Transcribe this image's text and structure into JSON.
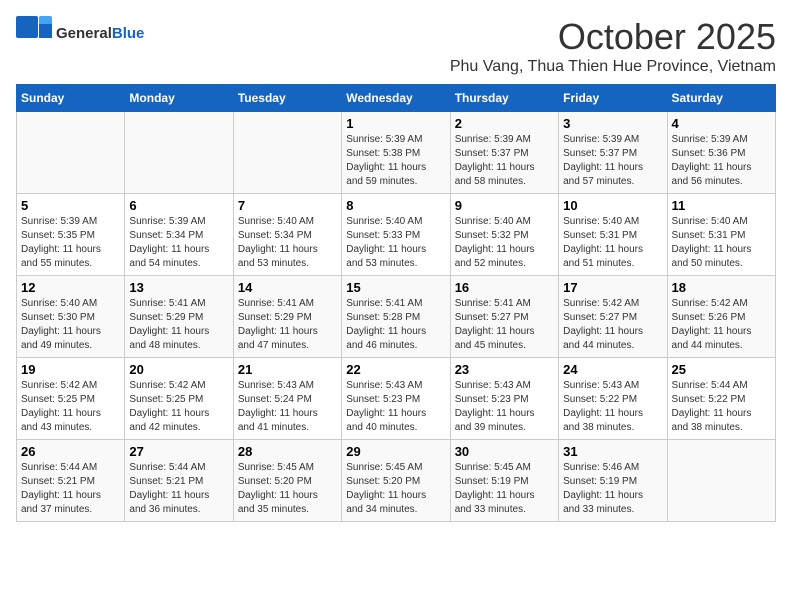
{
  "header": {
    "logo_general": "General",
    "logo_blue": "Blue",
    "month": "October 2025",
    "location": "Phu Vang, Thua Thien Hue Province, Vietnam"
  },
  "weekdays": [
    "Sunday",
    "Monday",
    "Tuesday",
    "Wednesday",
    "Thursday",
    "Friday",
    "Saturday"
  ],
  "weeks": [
    [
      {
        "day": "",
        "info": ""
      },
      {
        "day": "",
        "info": ""
      },
      {
        "day": "",
        "info": ""
      },
      {
        "day": "1",
        "info": "Sunrise: 5:39 AM\nSunset: 5:38 PM\nDaylight: 11 hours\nand 59 minutes."
      },
      {
        "day": "2",
        "info": "Sunrise: 5:39 AM\nSunset: 5:37 PM\nDaylight: 11 hours\nand 58 minutes."
      },
      {
        "day": "3",
        "info": "Sunrise: 5:39 AM\nSunset: 5:37 PM\nDaylight: 11 hours\nand 57 minutes."
      },
      {
        "day": "4",
        "info": "Sunrise: 5:39 AM\nSunset: 5:36 PM\nDaylight: 11 hours\nand 56 minutes."
      }
    ],
    [
      {
        "day": "5",
        "info": "Sunrise: 5:39 AM\nSunset: 5:35 PM\nDaylight: 11 hours\nand 55 minutes."
      },
      {
        "day": "6",
        "info": "Sunrise: 5:39 AM\nSunset: 5:34 PM\nDaylight: 11 hours\nand 54 minutes."
      },
      {
        "day": "7",
        "info": "Sunrise: 5:40 AM\nSunset: 5:34 PM\nDaylight: 11 hours\nand 53 minutes."
      },
      {
        "day": "8",
        "info": "Sunrise: 5:40 AM\nSunset: 5:33 PM\nDaylight: 11 hours\nand 53 minutes."
      },
      {
        "day": "9",
        "info": "Sunrise: 5:40 AM\nSunset: 5:32 PM\nDaylight: 11 hours\nand 52 minutes."
      },
      {
        "day": "10",
        "info": "Sunrise: 5:40 AM\nSunset: 5:31 PM\nDaylight: 11 hours\nand 51 minutes."
      },
      {
        "day": "11",
        "info": "Sunrise: 5:40 AM\nSunset: 5:31 PM\nDaylight: 11 hours\nand 50 minutes."
      }
    ],
    [
      {
        "day": "12",
        "info": "Sunrise: 5:40 AM\nSunset: 5:30 PM\nDaylight: 11 hours\nand 49 minutes."
      },
      {
        "day": "13",
        "info": "Sunrise: 5:41 AM\nSunset: 5:29 PM\nDaylight: 11 hours\nand 48 minutes."
      },
      {
        "day": "14",
        "info": "Sunrise: 5:41 AM\nSunset: 5:29 PM\nDaylight: 11 hours\nand 47 minutes."
      },
      {
        "day": "15",
        "info": "Sunrise: 5:41 AM\nSunset: 5:28 PM\nDaylight: 11 hours\nand 46 minutes."
      },
      {
        "day": "16",
        "info": "Sunrise: 5:41 AM\nSunset: 5:27 PM\nDaylight: 11 hours\nand 45 minutes."
      },
      {
        "day": "17",
        "info": "Sunrise: 5:42 AM\nSunset: 5:27 PM\nDaylight: 11 hours\nand 44 minutes."
      },
      {
        "day": "18",
        "info": "Sunrise: 5:42 AM\nSunset: 5:26 PM\nDaylight: 11 hours\nand 44 minutes."
      }
    ],
    [
      {
        "day": "19",
        "info": "Sunrise: 5:42 AM\nSunset: 5:25 PM\nDaylight: 11 hours\nand 43 minutes."
      },
      {
        "day": "20",
        "info": "Sunrise: 5:42 AM\nSunset: 5:25 PM\nDaylight: 11 hours\nand 42 minutes."
      },
      {
        "day": "21",
        "info": "Sunrise: 5:43 AM\nSunset: 5:24 PM\nDaylight: 11 hours\nand 41 minutes."
      },
      {
        "day": "22",
        "info": "Sunrise: 5:43 AM\nSunset: 5:23 PM\nDaylight: 11 hours\nand 40 minutes."
      },
      {
        "day": "23",
        "info": "Sunrise: 5:43 AM\nSunset: 5:23 PM\nDaylight: 11 hours\nand 39 minutes."
      },
      {
        "day": "24",
        "info": "Sunrise: 5:43 AM\nSunset: 5:22 PM\nDaylight: 11 hours\nand 38 minutes."
      },
      {
        "day": "25",
        "info": "Sunrise: 5:44 AM\nSunset: 5:22 PM\nDaylight: 11 hours\nand 38 minutes."
      }
    ],
    [
      {
        "day": "26",
        "info": "Sunrise: 5:44 AM\nSunset: 5:21 PM\nDaylight: 11 hours\nand 37 minutes."
      },
      {
        "day": "27",
        "info": "Sunrise: 5:44 AM\nSunset: 5:21 PM\nDaylight: 11 hours\nand 36 minutes."
      },
      {
        "day": "28",
        "info": "Sunrise: 5:45 AM\nSunset: 5:20 PM\nDaylight: 11 hours\nand 35 minutes."
      },
      {
        "day": "29",
        "info": "Sunrise: 5:45 AM\nSunset: 5:20 PM\nDaylight: 11 hours\nand 34 minutes."
      },
      {
        "day": "30",
        "info": "Sunrise: 5:45 AM\nSunset: 5:19 PM\nDaylight: 11 hours\nand 33 minutes."
      },
      {
        "day": "31",
        "info": "Sunrise: 5:46 AM\nSunset: 5:19 PM\nDaylight: 11 hours\nand 33 minutes."
      },
      {
        "day": "",
        "info": ""
      }
    ]
  ]
}
